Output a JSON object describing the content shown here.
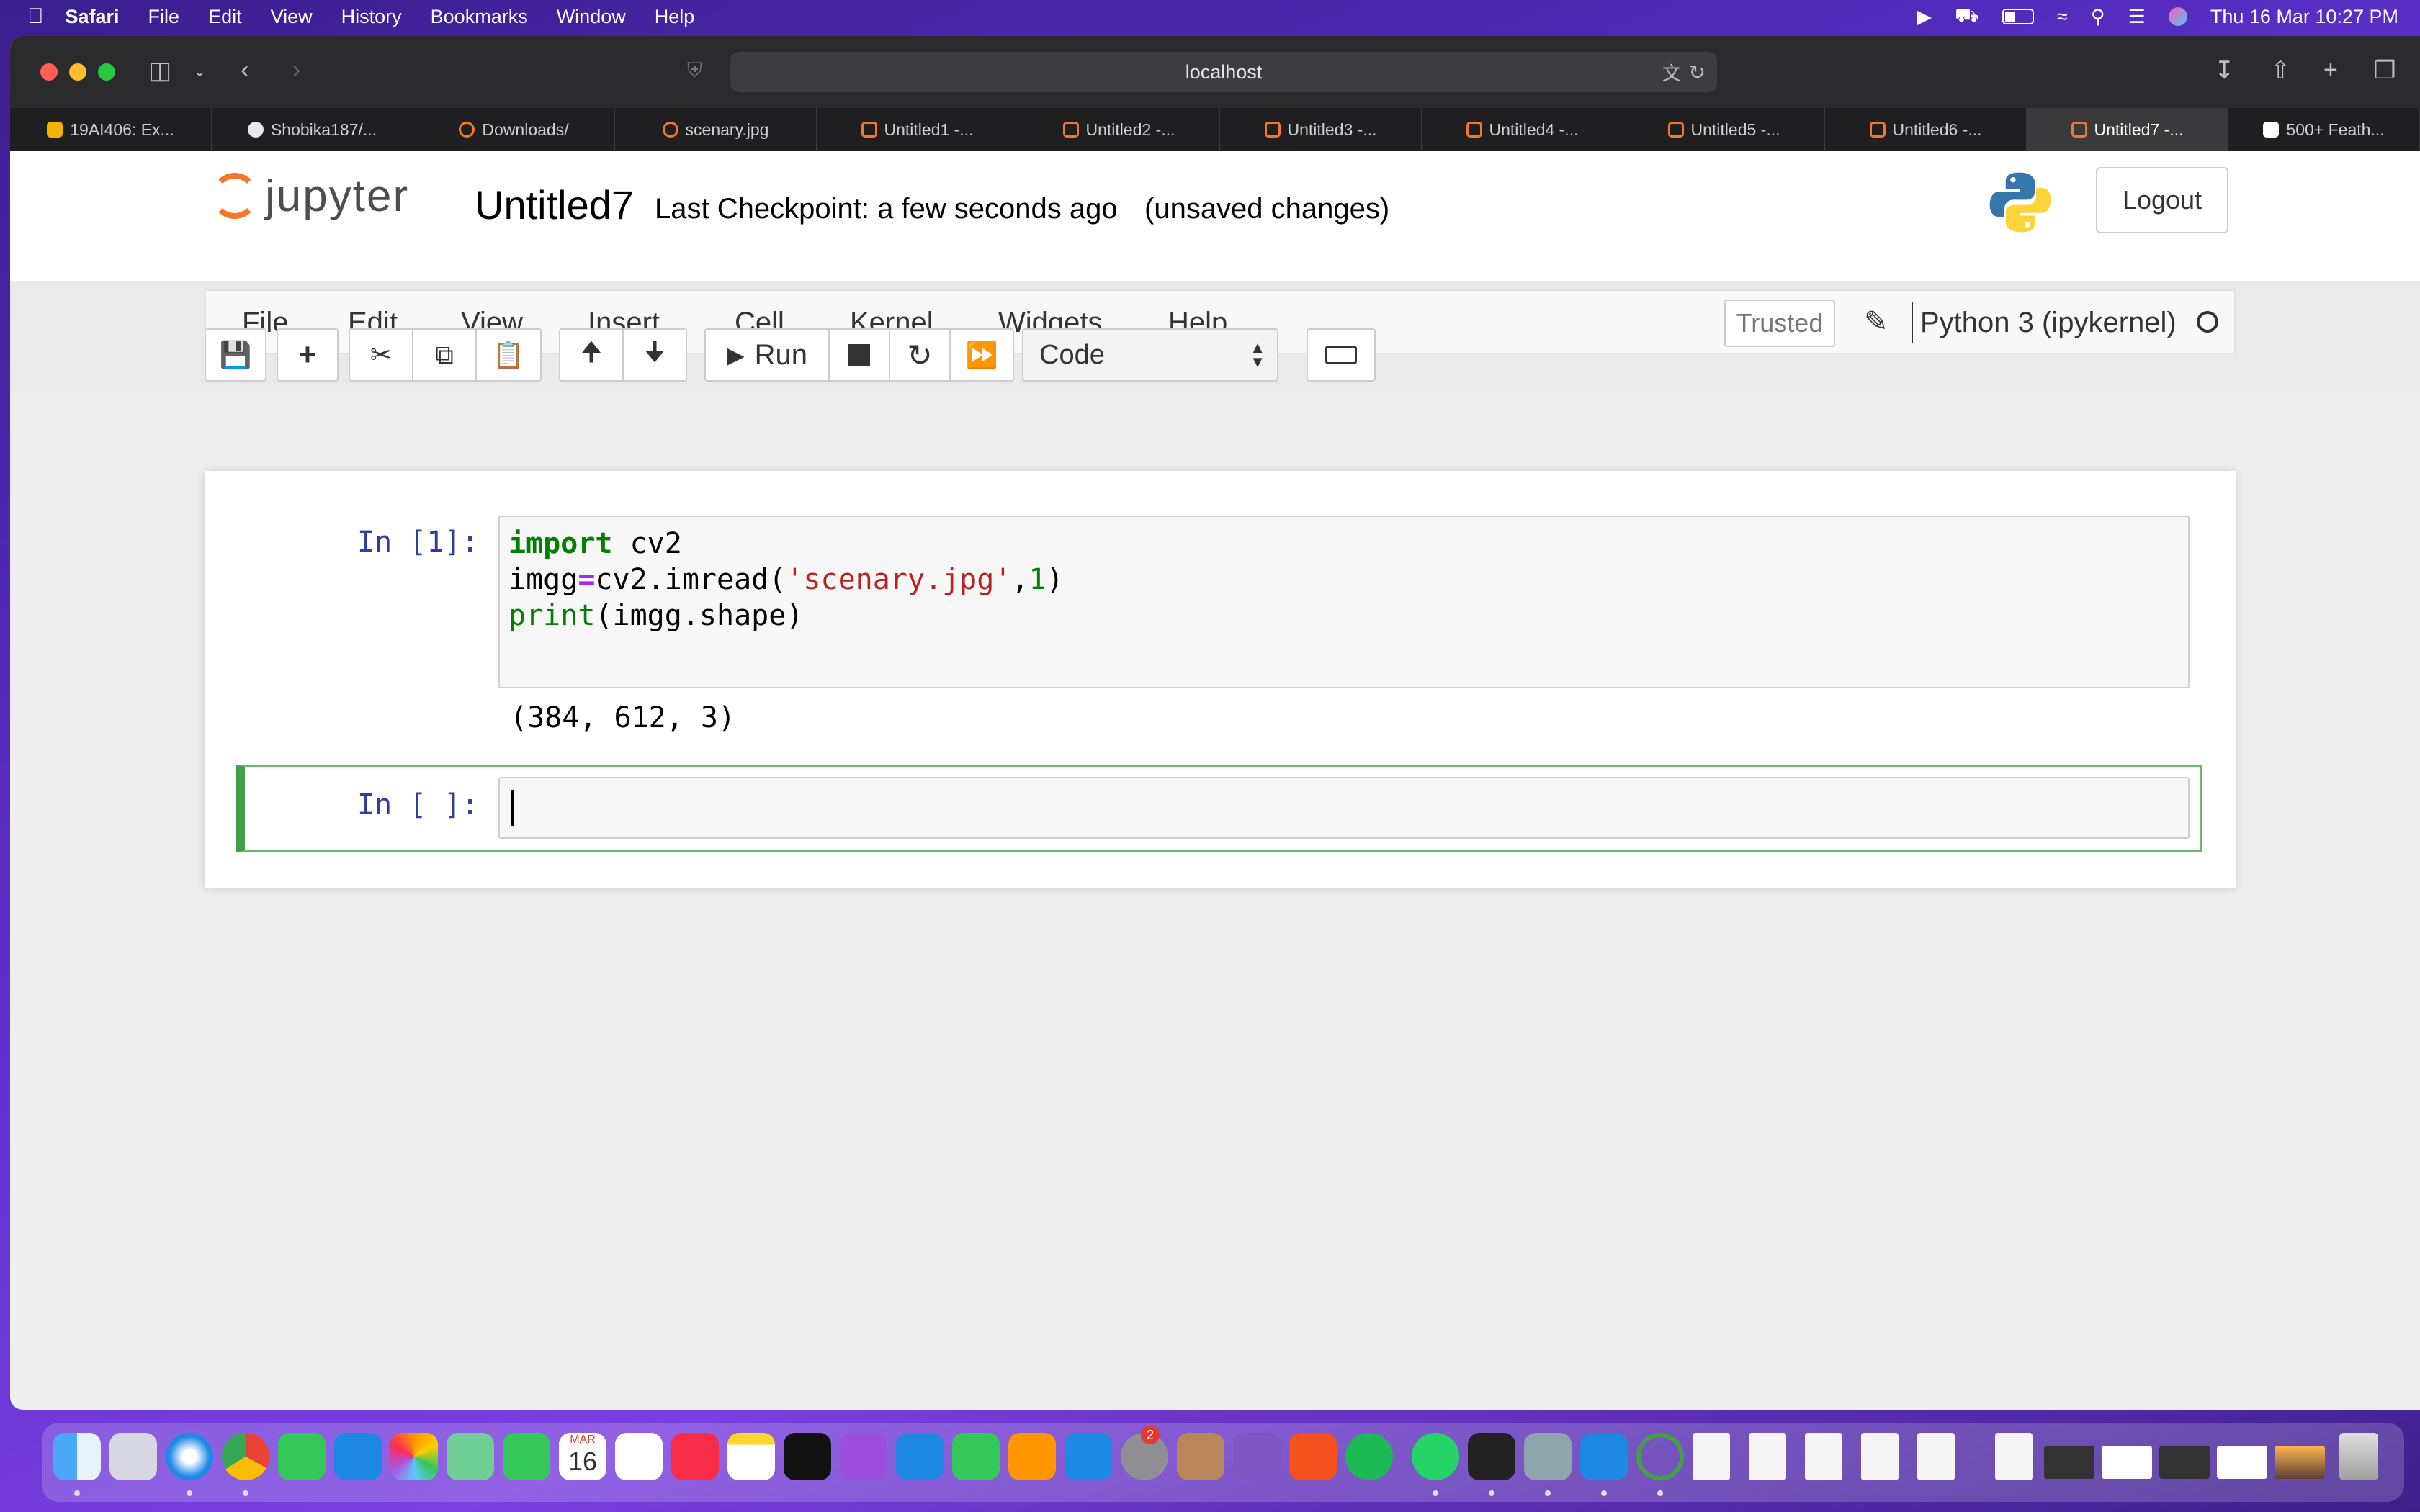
{
  "menubar": {
    "apple_icon": "apple-icon",
    "app": "Safari",
    "items": [
      "File",
      "Edit",
      "View",
      "History",
      "Bookmarks",
      "Window",
      "Help"
    ],
    "datetime": "Thu 16 Mar  10:27 PM"
  },
  "browser": {
    "url": "localhost",
    "tabs": [
      {
        "label": "19AI406: Ex...",
        "color": "#f0b400"
      },
      {
        "label": "Shobika187/...",
        "color": "#e8e8e8"
      },
      {
        "label": "Downloads/",
        "color": "#f37726"
      },
      {
        "label": "scenary.jpg",
        "color": "#f37726"
      },
      {
        "label": "Untitled1 -...",
        "color": "#f37726"
      },
      {
        "label": "Untitled2 -...",
        "color": "#f37726"
      },
      {
        "label": "Untitled3 -...",
        "color": "#f37726"
      },
      {
        "label": "Untitled4 -...",
        "color": "#f37726"
      },
      {
        "label": "Untitled5 -...",
        "color": "#f37726"
      },
      {
        "label": "Untitled6 -...",
        "color": "#f37726"
      },
      {
        "label": "Untitled7 -...",
        "color": "#f37726"
      },
      {
        "label": "500+ Feath...",
        "color": "#ffffff"
      }
    ],
    "active_tab": 10
  },
  "jupyter": {
    "logo_text": "jupyter",
    "notebook_title": "Untitled7",
    "checkpoint": "Last Checkpoint: a few seconds ago",
    "unsaved": "(unsaved changes)",
    "logout": "Logout",
    "menu": [
      "File",
      "Edit",
      "View",
      "Insert",
      "Cell",
      "Kernel",
      "Widgets",
      "Help"
    ],
    "trusted": "Trusted",
    "kernel": "Python 3 (ipykernel)",
    "toolbar": {
      "run": "Run",
      "cell_type": "Code"
    }
  },
  "cells": [
    {
      "prompt": "In [1]:",
      "output": "(384, 612, 3)"
    },
    {
      "prompt": "In [ ]:"
    }
  ],
  "code": {
    "line1_kw": "import",
    "line1_rest": " cv2",
    "line2_a": "imgg",
    "line2_op": "=",
    "line2_b": "cv2.imread(",
    "line2_str": "'scenary.jpg'",
    "line2_c": ",",
    "line2_num": "1",
    "line2_d": ")",
    "line3_bi": "print",
    "line3_rest": "(imgg.shape)"
  },
  "dock": {
    "calendar_month": "MAR",
    "calendar_day": "16",
    "settings_badge": "2",
    "apps": [
      "finder-icon",
      "launchpad-icon",
      "safari-icon",
      "chrome-icon",
      "messages-icon",
      "mail-icon",
      "photos-icon",
      "maps-icon",
      "facetime-icon",
      "calendar-icon",
      "reminders-icon",
      "music-icon",
      "notes-icon",
      "tv-icon",
      "podcasts-icon",
      "keynote-icon",
      "numbers-icon",
      "pages-icon",
      "app-store-icon",
      "system-settings-icon",
      "contacts-icon",
      "github-desktop-icon",
      "fusion360-icon",
      "spotify-icon",
      "whatsapp-icon",
      "terminal-icon",
      "preview-icon",
      "vscode-icon",
      "anaconda-icon",
      "file-icon",
      "file-icon",
      "file-icon",
      "file-icon",
      "file-icon",
      "file-icon",
      "window-thumb",
      "window-thumb",
      "window-thumb",
      "window-thumb",
      "window-thumb",
      "trash-icon"
    ]
  }
}
